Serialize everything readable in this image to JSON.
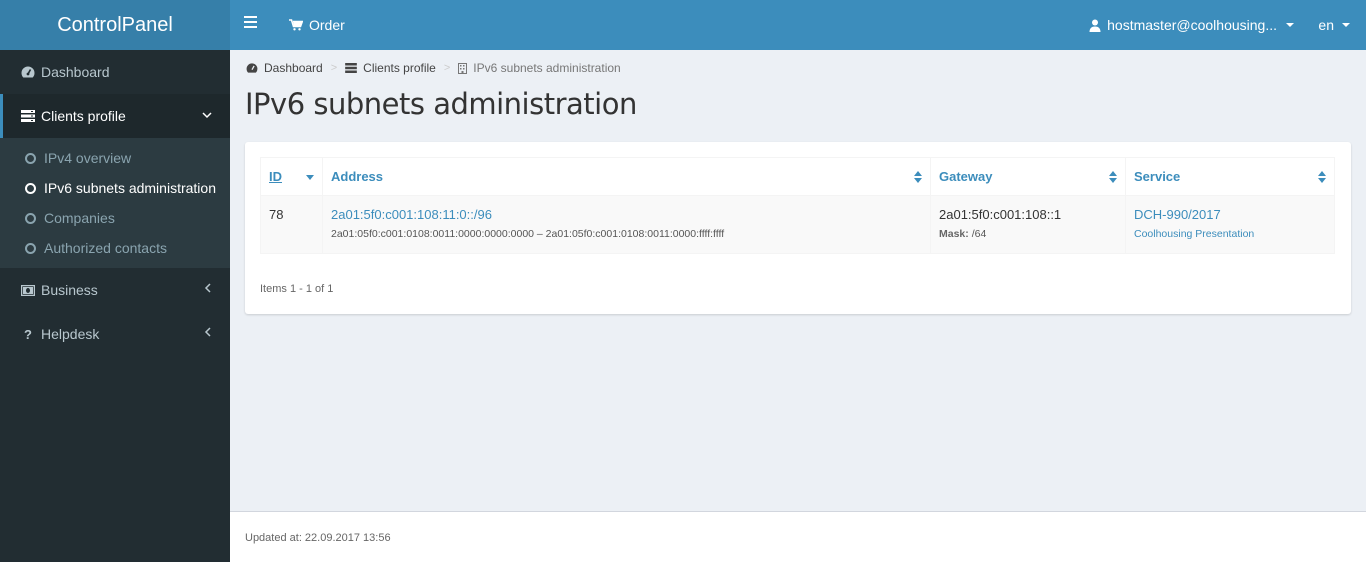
{
  "app": {
    "title": "ControlPanel"
  },
  "navbar": {
    "order_label": "Order",
    "user_label": "hostmaster@coolhousing...",
    "lang_label": "en"
  },
  "sidebar": {
    "items": [
      {
        "label": "Dashboard",
        "icon": "dashboard-icon"
      },
      {
        "label": "Clients profile",
        "icon": "server-icon",
        "expanded": true,
        "children": [
          {
            "label": "IPv4 overview"
          },
          {
            "label": "IPv6 subnets administration",
            "active": true
          },
          {
            "label": "Companies"
          },
          {
            "label": "Authorized contacts"
          }
        ]
      },
      {
        "label": "Business",
        "icon": "money-icon"
      },
      {
        "label": "Helpdesk",
        "icon": "question-icon"
      }
    ]
  },
  "breadcrumb": [
    {
      "label": "Dashboard",
      "icon": "dashboard-icon"
    },
    {
      "label": "Clients profile",
      "icon": "server-icon"
    },
    {
      "label": "IPv6 subnets administration",
      "icon": "building-icon"
    }
  ],
  "page": {
    "title": "IPv6 subnets administration"
  },
  "table": {
    "columns": [
      {
        "label": "ID",
        "sorted": "desc"
      },
      {
        "label": "Address"
      },
      {
        "label": "Gateway"
      },
      {
        "label": "Service"
      }
    ],
    "rows": [
      {
        "id": "78",
        "address": "2a01:5f0:c001:108:11:0::/96",
        "range": "2a01:05f0:c001:0108:0011:0000:0000:0000 – 2a01:05f0:c001:0108:0011:0000:ffff:ffff",
        "gateway": "2a01:5f0:c001:108::1",
        "mask_label": "Mask:",
        "mask": "/64",
        "service": "DCH-990/2017",
        "service_name": "Coolhousing Presentation"
      }
    ],
    "pager": "Items 1 - 1 of 1"
  },
  "footer": {
    "updated": "Updated at: 22.09.2017 13:56"
  }
}
